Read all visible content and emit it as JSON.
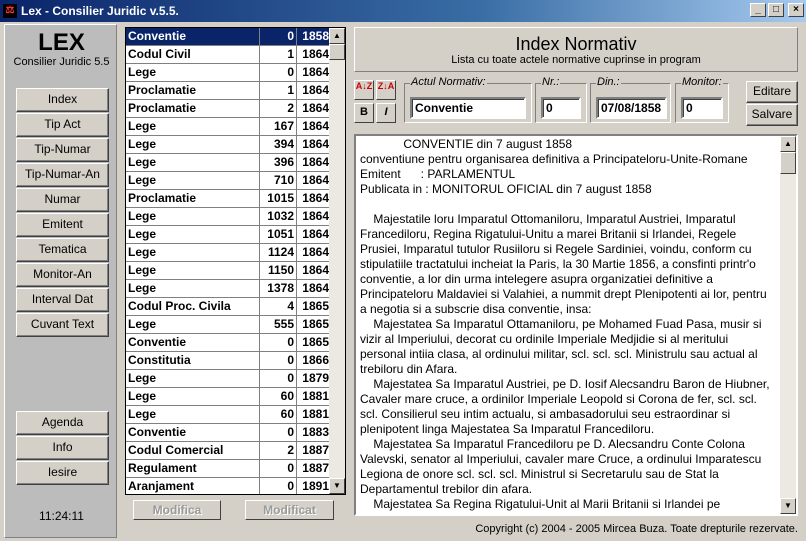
{
  "window": {
    "title": "Lex - Consilier Juridic v.5.5.",
    "app_icon": "scales-icon"
  },
  "sidebar": {
    "brand_title": "LEX",
    "brand_subtitle": "Consilier Juridic 5.5",
    "nav": [
      "Index",
      "Tip Act",
      "Tip-Numar",
      "Tip-Numar-An",
      "Numar",
      "Emitent",
      "Tematica",
      "Monitor-An",
      "Interval Dat",
      "Cuvant Text"
    ],
    "bottom": [
      "Agenda",
      "Info",
      "Iesire"
    ],
    "clock": "11:24:11"
  },
  "list": {
    "selected_index": 0,
    "rows": [
      [
        "Conventie",
        "0",
        "1858"
      ],
      [
        "Codul Civil",
        "1",
        "1864"
      ],
      [
        "Lege",
        "0",
        "1864"
      ],
      [
        "Proclamatie",
        "1",
        "1864"
      ],
      [
        "Proclamatie",
        "2",
        "1864"
      ],
      [
        "Lege",
        "167",
        "1864"
      ],
      [
        "Lege",
        "394",
        "1864"
      ],
      [
        "Lege",
        "396",
        "1864"
      ],
      [
        "Lege",
        "710",
        "1864"
      ],
      [
        "Proclamatie",
        "1015",
        "1864"
      ],
      [
        "Lege",
        "1032",
        "1864"
      ],
      [
        "Lege",
        "1051",
        "1864"
      ],
      [
        "Lege",
        "1124",
        "1864"
      ],
      [
        "Lege",
        "1150",
        "1864"
      ],
      [
        "Lege",
        "1378",
        "1864"
      ],
      [
        "Codul Proc. Civila",
        "4",
        "1865"
      ],
      [
        "Lege",
        "555",
        "1865"
      ],
      [
        "Conventie",
        "0",
        "1865"
      ],
      [
        "Constitutia",
        "0",
        "1866"
      ],
      [
        "Lege",
        "0",
        "1879"
      ],
      [
        "Lege",
        "60",
        "1881"
      ],
      [
        "Lege",
        "60",
        "1881"
      ],
      [
        "Conventie",
        "0",
        "1883"
      ],
      [
        "Codul Comercial",
        "2",
        "1887"
      ],
      [
        "Regulament",
        "0",
        "1887"
      ],
      [
        "Aranjament",
        "0",
        "1891"
      ]
    ],
    "modifica_label": "Modifica",
    "modificat_label": "Modificat"
  },
  "header": {
    "title": "Index Normativ",
    "subtitle": "Lista cu toate actele normative cuprinse in program"
  },
  "toolbar": {
    "sort_az": "A↓Z",
    "sort_za": "Z↓A",
    "bold": "B",
    "italic": "I"
  },
  "fields": {
    "act_label": "Actul Normativ:",
    "act_value": "Conventie",
    "nr_label": "Nr.:",
    "nr_value": "0",
    "din_label": "Din.:",
    "din_value": "07/08/1858",
    "monitor_label": "Monitor:",
    "monitor_value": "0"
  },
  "actions": {
    "editare": "Editare",
    "salvare": "Salvare"
  },
  "document": {
    "text": "             CONVENTIE din 7 august 1858\nconventiune pentru organisarea definitiva a Principateloru-Unite-Romane\nEmitent      : PARLAMENTUL\nPublicata in : MONITORUL OFICIAL din 7 august 1858\n\n    Majestatile loru Imparatul Ottomaniloru, Imparatul Austriei, Imparatul\nFrancediloru, Regina Rigatului-Unitu a marei Britanii si Irlandei, Regele\nPrusiei, Imparatul tutulor Rusiiloru si Regele Sardiniei, voindu, conform cu\nstipulatiile tractatului incheiat la Paris, la 30 Martie 1856, a consfinti printr'o\nconventie, a lor din urma intelegere asupra organizatiei definitive a\nPrincipateloru Maldaviei si Valahiei, a nummit drept Plenipotenti ai lor, pentru\na negotia si a subscrie disa conventie, insa:\n    Majestatea Sa Imparatul Ottamaniloru, pe Mohamed Fuad Pasa, musir si\nvizir al Imperiului, decorat cu ordinile Imperiale Medjidie si al meritului\npersonal intiia clasa, al ordinului militar, scl. scl. scl. Ministrulu sau actual al\ntrebiloru din Afara.\n    Majestatea Sa Imparatul Austriei, pe D. Iosif Alecsandru Baron de Hiubner,\nCavaler mare cruce, a ordinilor Imperiale Leopold si Corona de fer, scl. scl.\nscl. Consilierul seu intim actualu, si ambasadorului seu estraordinar si\nplenipotent linga Majestatea Sa Imparatul Francediloru.\n    Majestatea Sa Imparatul Francediloru pe D. Alecsandru Conte Colona\nValevski, senator al Imperiului, cavaler mare Cruce, a ordinului Imparatescu\nLegiona de onore scl. scl. scl. Ministrul si Secretarulu sau de Stat la\nDepartamentul trebilor din afara.\n    Majestatea Sa Regina Rigatului-Unit al Marii Britanii si Irlandei pe"
  },
  "footer": {
    "copyright": "Copyright (c) 2004 - 2005 Mircea Buza. Toate drepturile rezervate."
  }
}
